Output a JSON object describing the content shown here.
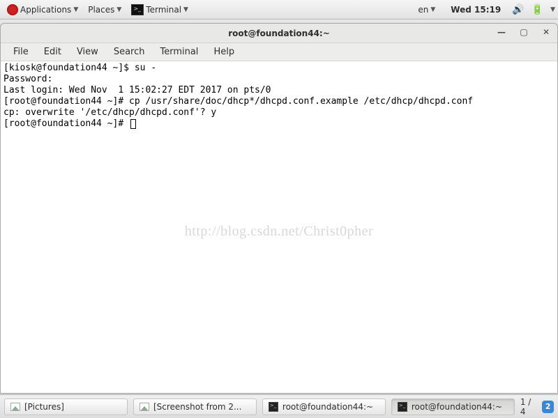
{
  "top_panel": {
    "applications": "Applications",
    "places": "Places",
    "task_label": "Terminal",
    "lang": "en",
    "clock": "Wed 15:19"
  },
  "window": {
    "title": "root@foundation44:~",
    "menus": {
      "file": "File",
      "edit": "Edit",
      "view": "View",
      "search": "Search",
      "terminal": "Terminal",
      "help": "Help"
    }
  },
  "terminal_lines": {
    "l1": "[kiosk@foundation44 ~]$ su -",
    "l2": "Password:",
    "l3": "Last login: Wed Nov  1 15:02:27 EDT 2017 on pts/0",
    "l4": "[root@foundation44 ~]# cp /usr/share/doc/dhcp*/dhcpd.conf.example /etc/dhcp/dhcpd.conf",
    "l5": "cp: overwrite '/etc/dhcp/dhcpd.conf'? y",
    "l6": "[root@foundation44 ~]# "
  },
  "watermark": "http://blog.csdn.net/Christ0pher",
  "taskbar": {
    "t1": "[Pictures]",
    "t2": "[Screenshot from 2...",
    "t3": "root@foundation44:~",
    "t4": "root@foundation44:~",
    "ws_label": "1 / 4",
    "ws_badge": "2"
  }
}
